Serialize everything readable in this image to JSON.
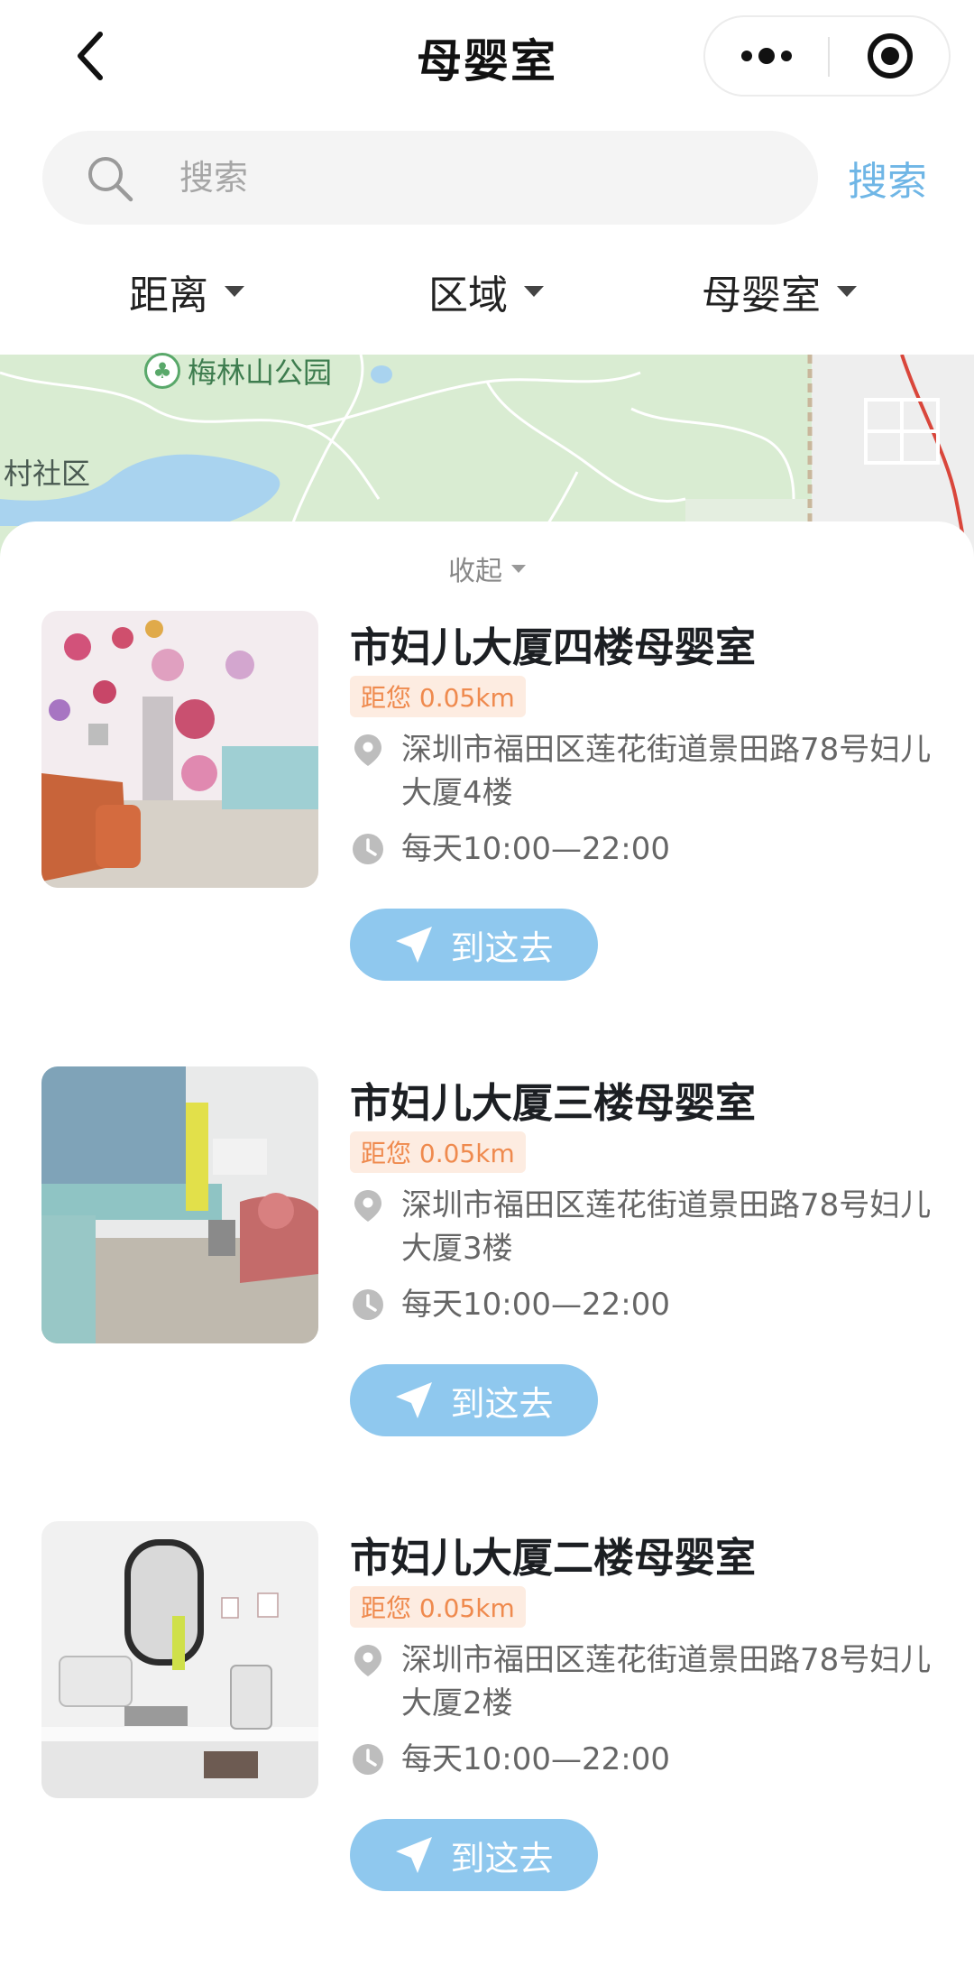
{
  "nav": {
    "title": "母婴室"
  },
  "search": {
    "placeholder": "搜索",
    "value": "",
    "button_label": "搜索"
  },
  "filters": [
    {
      "label": "距离"
    },
    {
      "label": "区域"
    },
    {
      "label": "母婴室"
    }
  ],
  "map": {
    "park_label": "梅林山公园",
    "village_label": "村社区"
  },
  "sheet": {
    "collapse_label": "收起"
  },
  "rooms": [
    {
      "name": "市妇儿大厦四楼母婴室",
      "distance": "距您 0.05km",
      "address": "深圳市福田区莲花街道景田路78号妇儿大厦4楼",
      "hours": "每天10:00—22:00",
      "button_label": "到这去"
    },
    {
      "name": "市妇儿大厦三楼母婴室",
      "distance": "距您 0.05km",
      "address": "深圳市福田区莲花街道景田路78号妇儿大厦3楼",
      "hours": "每天10:00—22:00",
      "button_label": "到这去"
    },
    {
      "name": "市妇儿大厦二楼母婴室",
      "distance": "距您 0.05km",
      "address": "深圳市福田区莲花街道景田路78号妇儿大厦2楼",
      "hours": "每天10:00—22:00",
      "button_label": "到这去"
    }
  ],
  "colors": {
    "accent": "#6fb6e6",
    "button_bg": "#8fc8ee",
    "distance_bg": "#fdece1",
    "distance_text": "#ef8a4e",
    "map_bg": "#d9ecd2"
  },
  "icons": {
    "back": "chevron-left-icon",
    "more": "more-dots-icon",
    "close": "target-circle-icon",
    "search": "search-icon",
    "location": "location-pin-icon",
    "clock": "clock-icon",
    "navigate": "navigation-arrow-icon"
  }
}
